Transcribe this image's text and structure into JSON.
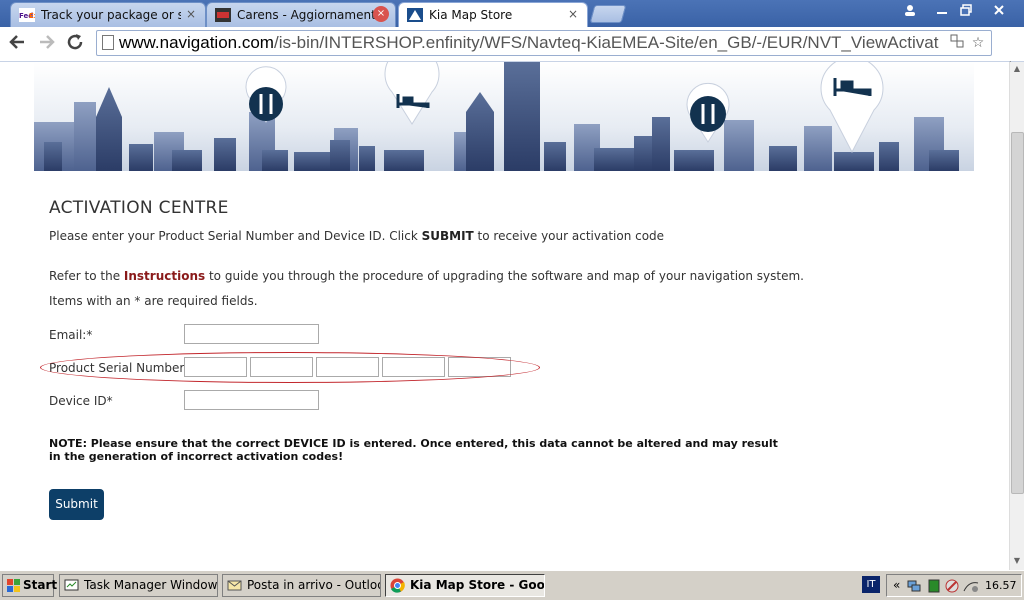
{
  "browser": {
    "tabs": [
      {
        "title": "Track your package or shipm",
        "favicon": "fedex-icon",
        "close": "×"
      },
      {
        "title": "Carens - Aggiornamento sw",
        "favicon": "forum-icon",
        "close": "×"
      },
      {
        "title": "Kia Map Store",
        "favicon": "navteq-icon",
        "close": "×"
      }
    ],
    "url_prefix": "www.navigation.com",
    "url_path": "/is-bin/INTERSHOP.enfinity/WFS/Navteq-KiaEMEA-Site/en_GB/-/EUR/NVT_ViewActivation-Disp..."
  },
  "page": {
    "heading": "ACTIVATION CENTRE",
    "intro_before": "Please enter your Product Serial Number and Device ID. Click ",
    "intro_bold": "SUBMIT",
    "intro_after": " to receive your activation code",
    "refer_before": "Refer to the ",
    "refer_link": "Instructions",
    "refer_after": " to guide you through the procedure of upgrading the software and map of your navigation system.",
    "required_note": "Items with an * are required fields.",
    "email_label": "Email:*",
    "serial_label": "Product Serial Number:*",
    "device_label": "Device ID*",
    "note_text": "NOTE: Please ensure that the correct DEVICE ID is entered. Once entered, this data cannot be altered and may result in the generation of incorrect activation codes!",
    "submit_label": "Submit"
  },
  "taskbar": {
    "start_label": "Start",
    "items": [
      {
        "label": "Task Manager Windows"
      },
      {
        "label": "Posta in arrivo - Outlook ..."
      },
      {
        "label": "Kia Map Store - Googl..."
      }
    ],
    "language": "IT",
    "time": "16.57"
  },
  "colors": {
    "accent": "#0d3f68",
    "link": "#8a1a1a",
    "highlight_ellipse": "#c2272d"
  }
}
